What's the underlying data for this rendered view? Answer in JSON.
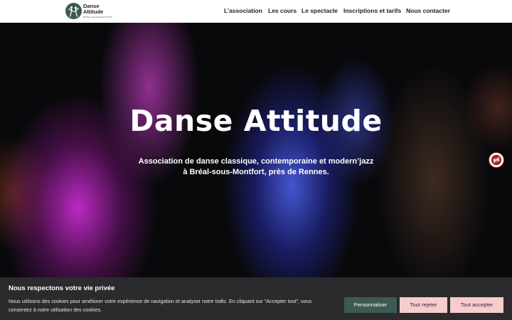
{
  "header": {
    "logo": {
      "name_line1": "Danse",
      "name_line2": "Attitude",
      "tagline": "BRÉAL-SOUS-MONTFORT",
      "mark_icon": "dancers-logo-icon"
    },
    "nav": [
      "L’association",
      "Les cours",
      "Le spectacle",
      "Inscriptions et tarifs",
      "Nous contacter"
    ]
  },
  "hero": {
    "title": "Danse Attitude",
    "subtitle_line1": "Association de danse classique, contemporaine et modern’jazz",
    "subtitle_line2": "à Bréal-sous-Montfort, près de Rennes."
  },
  "accessibility_button": {
    "icon": "accessibility-eye-icon"
  },
  "cookie_banner": {
    "title": "Nous respectons votre vie privée",
    "text": "Nous utilisons des cookies pour améliorer votre expérience de navigation et analyser notre trafic. En cliquant sur \"Accepter tout\", vous consentez à notre utilisation des cookies.",
    "buttons": {
      "customize": "Personnaliser",
      "reject": "Tout rejeter",
      "accept": "Tout accepter"
    }
  },
  "colors": {
    "brand_green": "#3b5a52",
    "button_pink": "#f6cccc",
    "banner_bg": "#2b2b2e"
  }
}
